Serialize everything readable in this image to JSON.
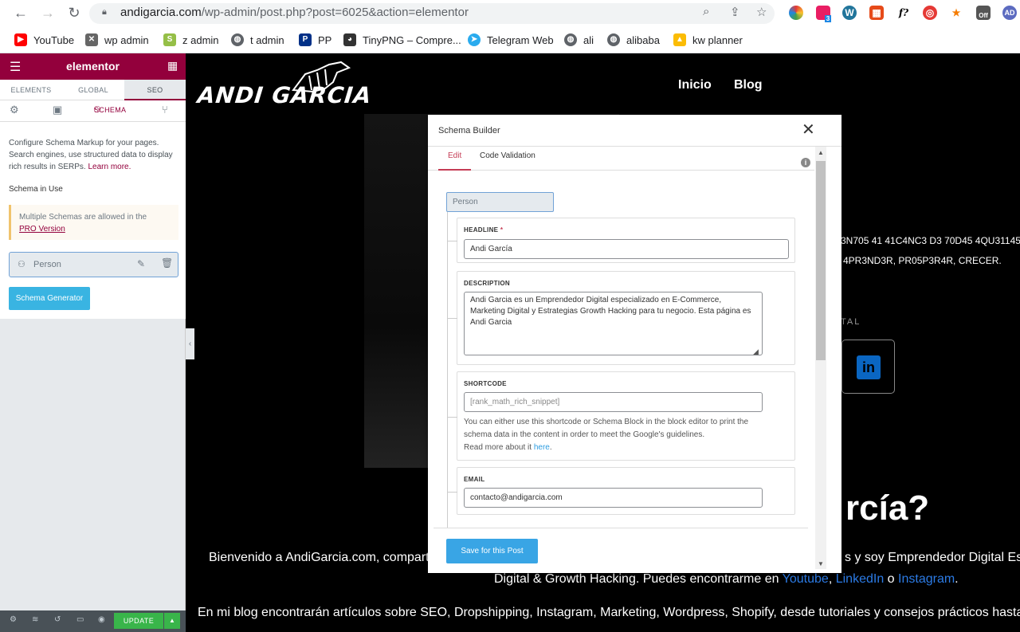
{
  "browser": {
    "url_domain": "andigarcia.com",
    "url_path": "/wp-admin/post.php?post=6025&action=elementor",
    "bookmarks": [
      {
        "label": "YouTube",
        "icon": "youtube-icon",
        "color": "#ff0000"
      },
      {
        "label": "wp admin",
        "icon": "wp-admin-icon",
        "color": "#666666"
      },
      {
        "label": "z admin",
        "icon": "shopify-icon",
        "color": "#95bf47"
      },
      {
        "label": "t admin",
        "icon": "globe-icon",
        "color": "#5f6368"
      },
      {
        "label": "PP",
        "icon": "paypal-icon",
        "color": "#003087"
      },
      {
        "label": "TinyPNG – Compre...",
        "icon": "panda-icon",
        "color": "#333333"
      },
      {
        "label": "Telegram Web",
        "icon": "telegram-icon",
        "color": "#2aabee"
      },
      {
        "label": "ali",
        "icon": "globe-icon",
        "color": "#5f6368"
      },
      {
        "label": "alibaba",
        "icon": "globe-icon",
        "color": "#5f6368"
      },
      {
        "label": "kw planner",
        "icon": "google-ads-icon",
        "color": "#fbbc04"
      }
    ],
    "extension_badge": "3",
    "extension_off": "Off"
  },
  "elementor": {
    "brand": "elementor",
    "tabs": [
      "ELEMENTS",
      "GLOBAL",
      "SEO"
    ],
    "active_tab": "SEO",
    "subtab_label": "SCHEMA",
    "description": "Configure Schema Markup for your pages. Search engines, use structured data to display rich results in SERPs.",
    "learn_more": "Learn more.",
    "schema_in_use": "Schema in Use",
    "multiple_notice": "Multiple Schemas are allowed in the",
    "pro_link": "PRO Version",
    "schema_item": "Person",
    "generator_button": "Schema Generator",
    "update_button": "UPDATE",
    "accent": "#93003c"
  },
  "site": {
    "logo": "ANDI GARCIA",
    "nav": [
      "Inicio",
      "Blog"
    ],
    "line1": "3N705 41 41C4NC3 D3 70D45 4QU31145",
    "line2": "4PR3ND3R, PR05P3R4R, CRECER.",
    "label_partial": "TAL",
    "heading_partial": "rcía?",
    "para1_left": "Bienvenido a AndiGarcia.com, compart",
    "para1_right": "s y soy Emprendedor Digital Esp",
    "para2_pre": "Digital & Growth Hacking. Puedes encontrarme en",
    "para2_links": [
      "Youtube",
      "LinkedIn",
      "Instagram"
    ],
    "para2_sep1": ",",
    "para2_sep2": "o",
    "para3": "En mi blog encontrarán artículos sobre SEO, Dropshipping, Instagram, Marketing, Wordpress, Shopify, desde tutoriales y consejos prácticos hasta refle",
    "linkedin_text": "in"
  },
  "modal": {
    "title": "Schema Builder",
    "tabs": [
      "Edit",
      "Code Validation"
    ],
    "schema_type": "Person",
    "fields": {
      "headline": {
        "label": "HEADLINE",
        "required_mark": "*",
        "value": "Andi García"
      },
      "description": {
        "label": "DESCRIPTION",
        "value": "Andi Garcia es un Emprendedor Digital especializado en E-Commerce, Marketing Digital y Estrategias Growth Hacking para tu negocio. Esta página es Andi Garcia"
      },
      "shortcode": {
        "label": "SHORTCODE",
        "value": "[rank_math_rich_snippet]",
        "help": "You can either use this shortcode or Schema Block in the block editor to print the schema data in the content in order to meet the Google's guidelines.",
        "help_more": "Read more about it",
        "help_link": "here"
      },
      "email": {
        "label": "EMAIL",
        "value": "contacto@andigarcia.com"
      }
    },
    "save_button": "Save for this Post"
  }
}
